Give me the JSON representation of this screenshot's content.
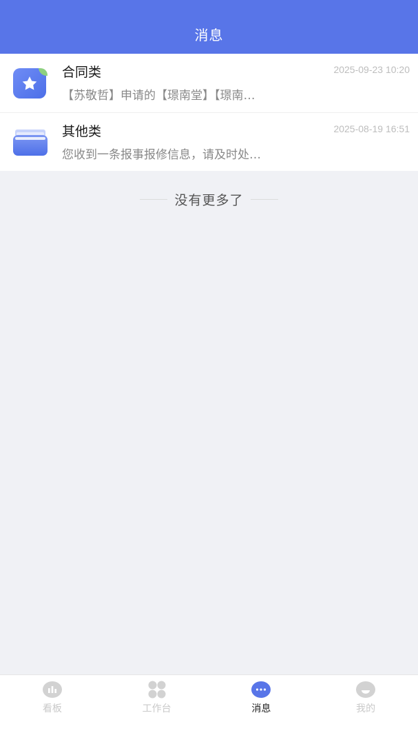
{
  "header": {
    "title": "消息"
  },
  "messages": [
    {
      "title": "合同类",
      "time": "2025-09-23 10:20",
      "preview": "【苏敬哲】申请的【璟南堂】【璟南…",
      "icon": "star-folder-icon"
    },
    {
      "title": "其他类",
      "time": "2025-08-19 16:51",
      "preview": "您收到一条报事报修信息，请及时处…",
      "icon": "drawer-icon"
    }
  ],
  "no_more": "没有更多了",
  "tabbar": {
    "active": "消息",
    "tabs": [
      {
        "label": "看板",
        "icon": "chart-icon"
      },
      {
        "label": "工作台",
        "icon": "grid-icon"
      },
      {
        "label": "消息",
        "icon": "message-icon"
      },
      {
        "label": "我的",
        "icon": "profile-icon"
      }
    ]
  },
  "colors": {
    "header_bg": "#5875e8",
    "accent": "#5875e8",
    "page_bg": "#f0f1f5",
    "inactive_tab": "#c9c9c9"
  }
}
